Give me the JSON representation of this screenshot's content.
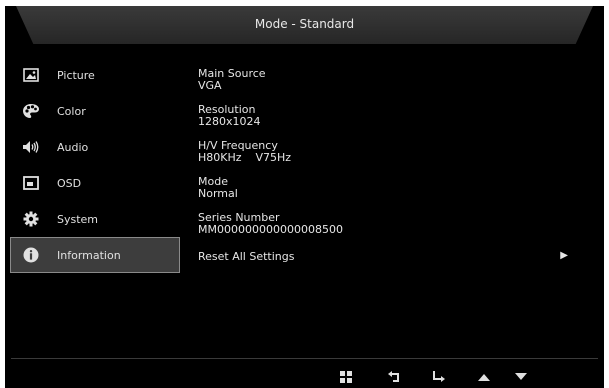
{
  "title": "Mode - Standard",
  "menu": {
    "items": [
      {
        "label": "Picture",
        "icon": "picture-icon"
      },
      {
        "label": "Color",
        "icon": "palette-icon"
      },
      {
        "label": "Audio",
        "icon": "speaker-icon"
      },
      {
        "label": "OSD",
        "icon": "osd-window-icon"
      },
      {
        "label": "System",
        "icon": "gear-icon"
      },
      {
        "label": "Information",
        "icon": "info-icon",
        "selected": true
      }
    ]
  },
  "information": {
    "main_source": {
      "label": "Main Source",
      "value": "VGA"
    },
    "resolution": {
      "label": "Resolution",
      "value": "1280x1024"
    },
    "frequency": {
      "label": "H/V Frequency",
      "value": "H80KHz    V75Hz"
    },
    "mode": {
      "label": "Mode",
      "value": "Normal"
    },
    "series_number": {
      "label": "Series Number",
      "value": "MM000000000000008500"
    },
    "reset": {
      "label": "Reset All Settings"
    }
  },
  "buttons": [
    "menu-grid-icon",
    "back-icon",
    "enter-icon",
    "up-arrow-icon",
    "down-arrow-icon"
  ],
  "colors": {
    "background": "#000000",
    "selected_bg": "#3d3d3d",
    "selected_border": "#8a8a8a",
    "text": "#e6e6e6"
  }
}
